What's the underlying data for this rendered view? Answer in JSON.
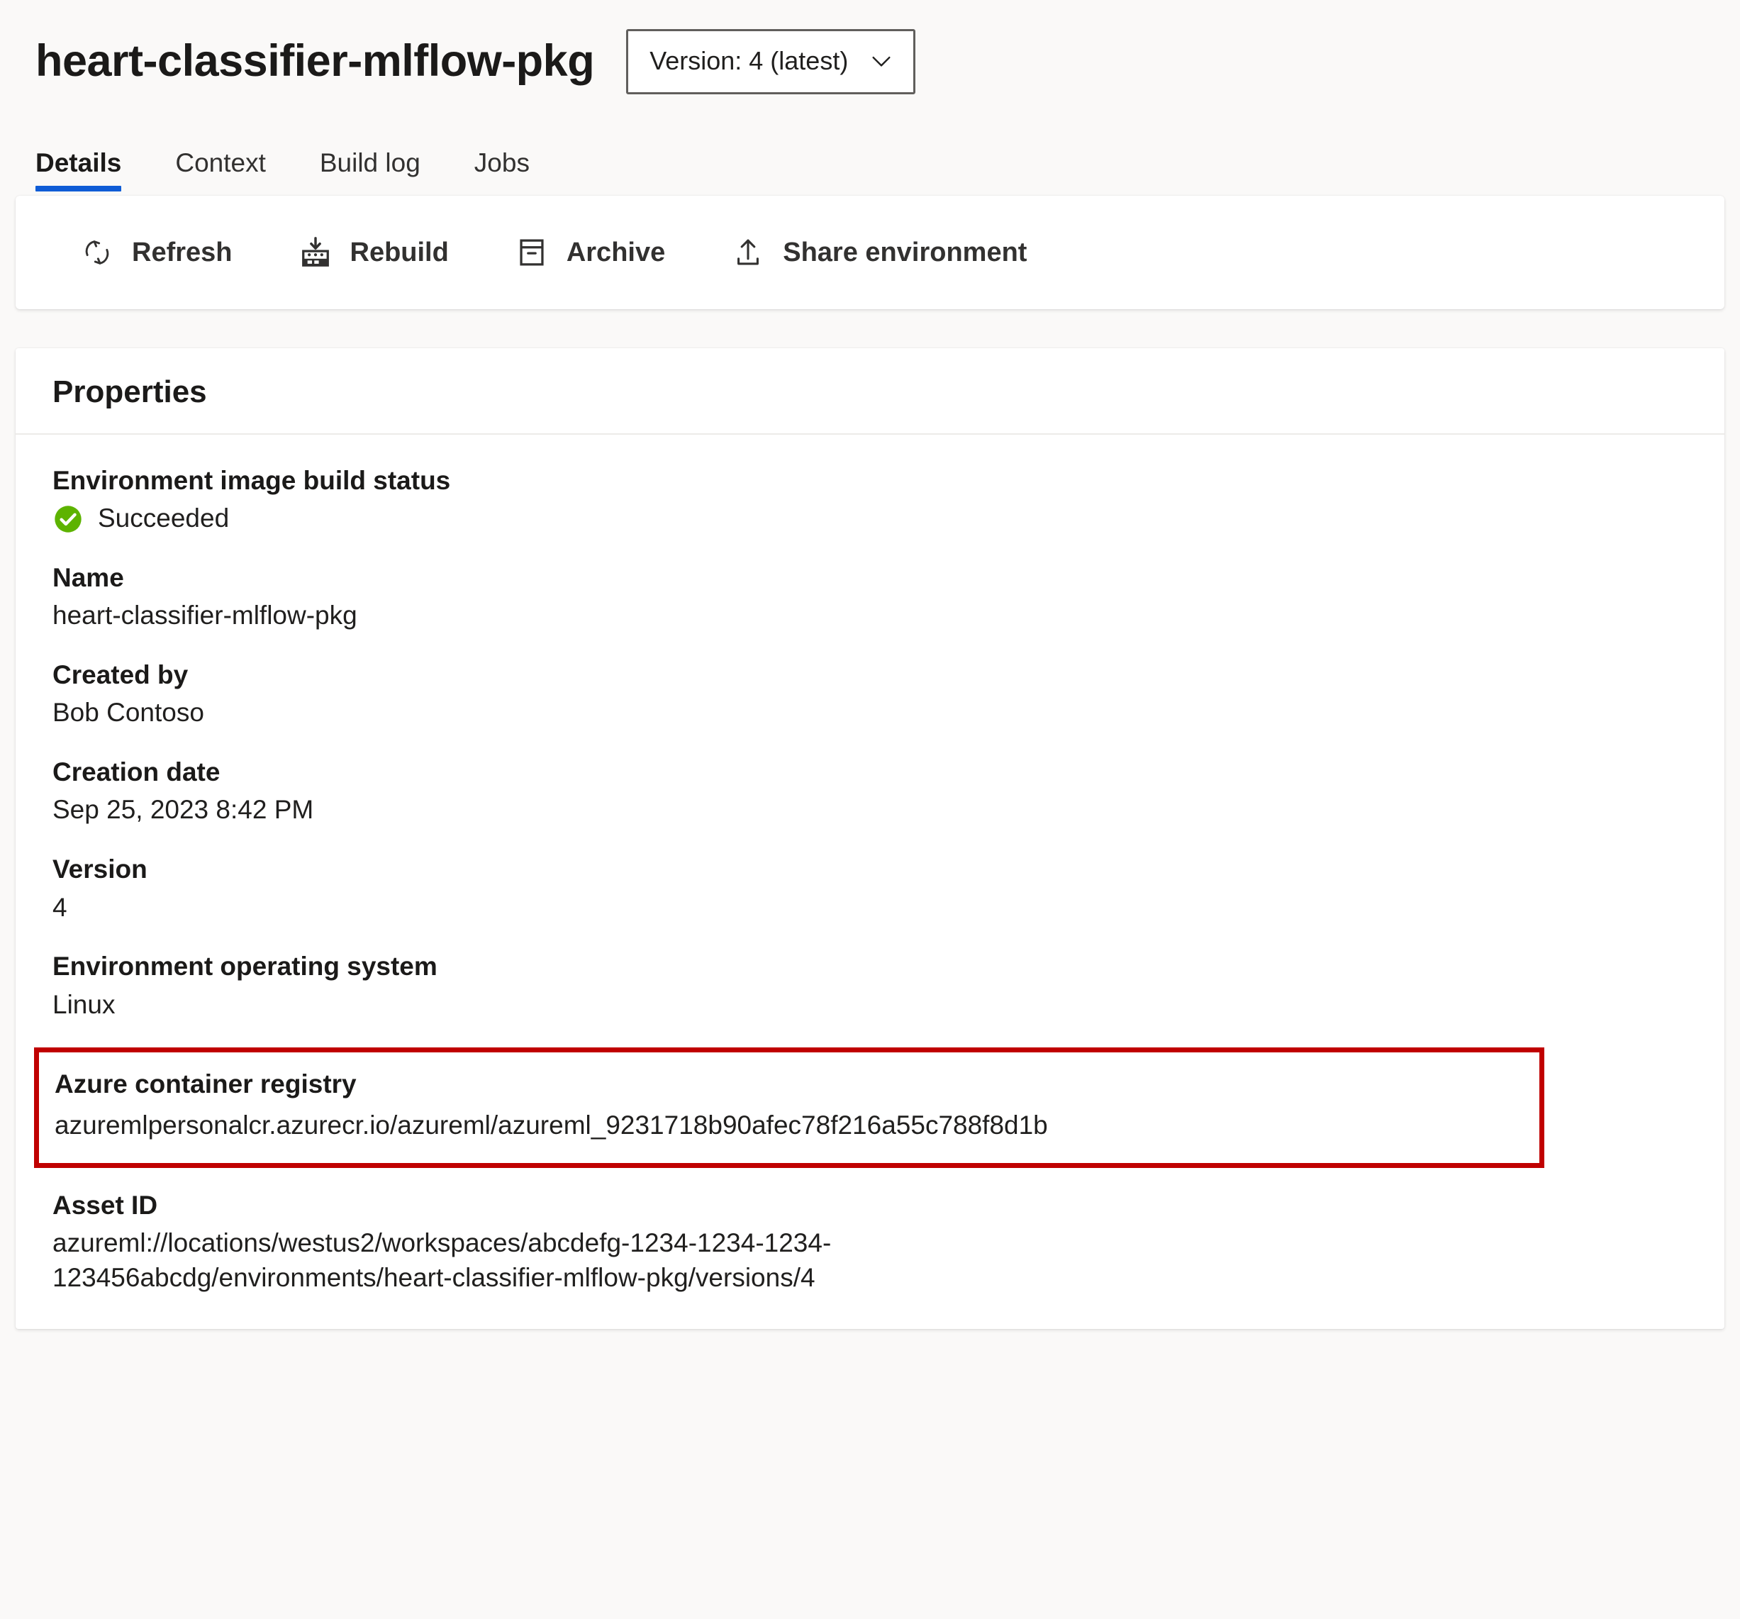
{
  "header": {
    "title": "heart-classifier-mlflow-pkg",
    "version_picker": {
      "label": "Version: 4 (latest)",
      "icon": "chevron-down-icon"
    }
  },
  "tabs": [
    {
      "label": "Details",
      "active": true
    },
    {
      "label": "Context",
      "active": false
    },
    {
      "label": "Build log",
      "active": false
    },
    {
      "label": "Jobs",
      "active": false
    }
  ],
  "commandbar": {
    "items": [
      {
        "label": "Refresh",
        "icon": "refresh-icon"
      },
      {
        "label": "Rebuild",
        "icon": "rebuild-icon"
      },
      {
        "label": "Archive",
        "icon": "archive-icon"
      },
      {
        "label": "Share environment",
        "icon": "share-upload-icon"
      }
    ]
  },
  "properties_card": {
    "title": "Properties",
    "build_status": {
      "label": "Environment image build status",
      "value": "Succeeded",
      "icon": "success-check-icon",
      "icon_color": "#5DB300"
    },
    "name": {
      "label": "Name",
      "value": "heart-classifier-mlflow-pkg"
    },
    "created_by": {
      "label": "Created by",
      "value": "Bob Contoso"
    },
    "creation_date": {
      "label": "Creation date",
      "value": "Sep 25, 2023 8:42 PM"
    },
    "version": {
      "label": "Version",
      "value": "4"
    },
    "operating_system": {
      "label": "Environment operating system",
      "value": "Linux"
    },
    "container_registry": {
      "label": "Azure container registry",
      "value": "azuremlpersonalcr.azurecr.io/azureml/azureml_9231718b90afec78f216a55c788f8d1b",
      "highlight_color": "#C00000"
    },
    "asset_id": {
      "label": "Asset ID",
      "value": "azureml://locations/westus2/workspaces/abcdefg-1234-1234-1234-123456abcdg/environments/heart-classifier-mlflow-pkg/versions/4"
    }
  },
  "colors": {
    "accent": "#0F5CD6",
    "success": "#5DB300",
    "highlight": "#C00000",
    "page_bg": "#FAF9F8",
    "card_bg": "#FFFFFF"
  }
}
